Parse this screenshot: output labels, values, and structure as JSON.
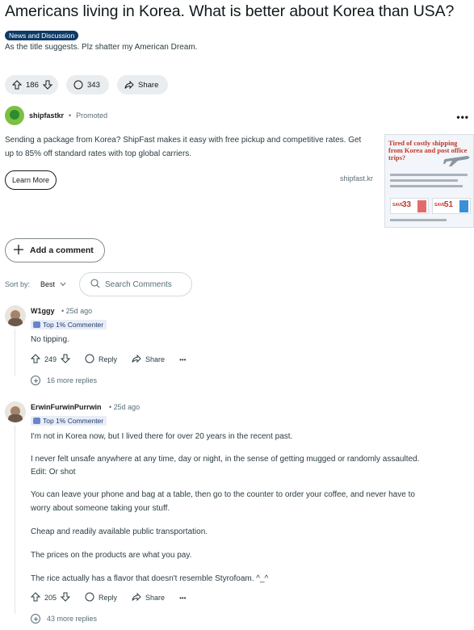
{
  "post": {
    "title": "Americans living in Korea. What is better about Korea than USA?",
    "flair": "News and Discussion",
    "body": "As the title suggests. Plz shatter my American Dream.",
    "votes": "186",
    "comments": "343",
    "share_label": "Share"
  },
  "ad": {
    "name": "shipfastkr",
    "promoted": "Promoted",
    "more": "•••",
    "text": "Sending a package from Korea? ShipFast makes it easy with free pickup and competitive rates. Get up to 85% off standard rates with top global carriers.",
    "cta": "Learn More",
    "domain": "shipfast.kr",
    "image_title": "Tired of costly shipping from Korea and post office trips?",
    "discount_1": "33",
    "discount_2": "51",
    "save_label": "SAVE"
  },
  "add_comment": "Add a comment",
  "sort": {
    "label": "Sort by:",
    "value": "Best"
  },
  "search": {
    "placeholder": "Search Comments"
  },
  "comments": [
    {
      "author": "W1ggy",
      "time": "25d ago",
      "badge": "Top 1% Commenter",
      "text": [
        "No tipping."
      ],
      "votes": "249",
      "reply": "Reply",
      "share": "Share",
      "more": "•••",
      "more_replies": "16 more replies"
    },
    {
      "author": "ErwinFurwinPurrwin",
      "time": "25d ago",
      "badge": "Top 1% Commenter",
      "text": [
        "I'm not in Korea now, but I lived there for over 20 years in the recent past.",
        "I never felt unsafe anywhere at any time, day or night, in the sense of getting mugged or randomly assaulted.",
        "Edit: Or shot",
        "You can leave your phone and bag at a table, then go to the counter to order your coffee, and never have to",
        "worry about someone taking your stuff.",
        "Cheap and readily available public transportation.",
        "The prices on the products are what you pay.",
        "The rice actually has a flavor that doesn't resemble Styrofoam. ^_^"
      ],
      "votes": "205",
      "reply": "Reply",
      "share": "Share",
      "more": "•••",
      "more_replies": "43 more replies"
    }
  ]
}
